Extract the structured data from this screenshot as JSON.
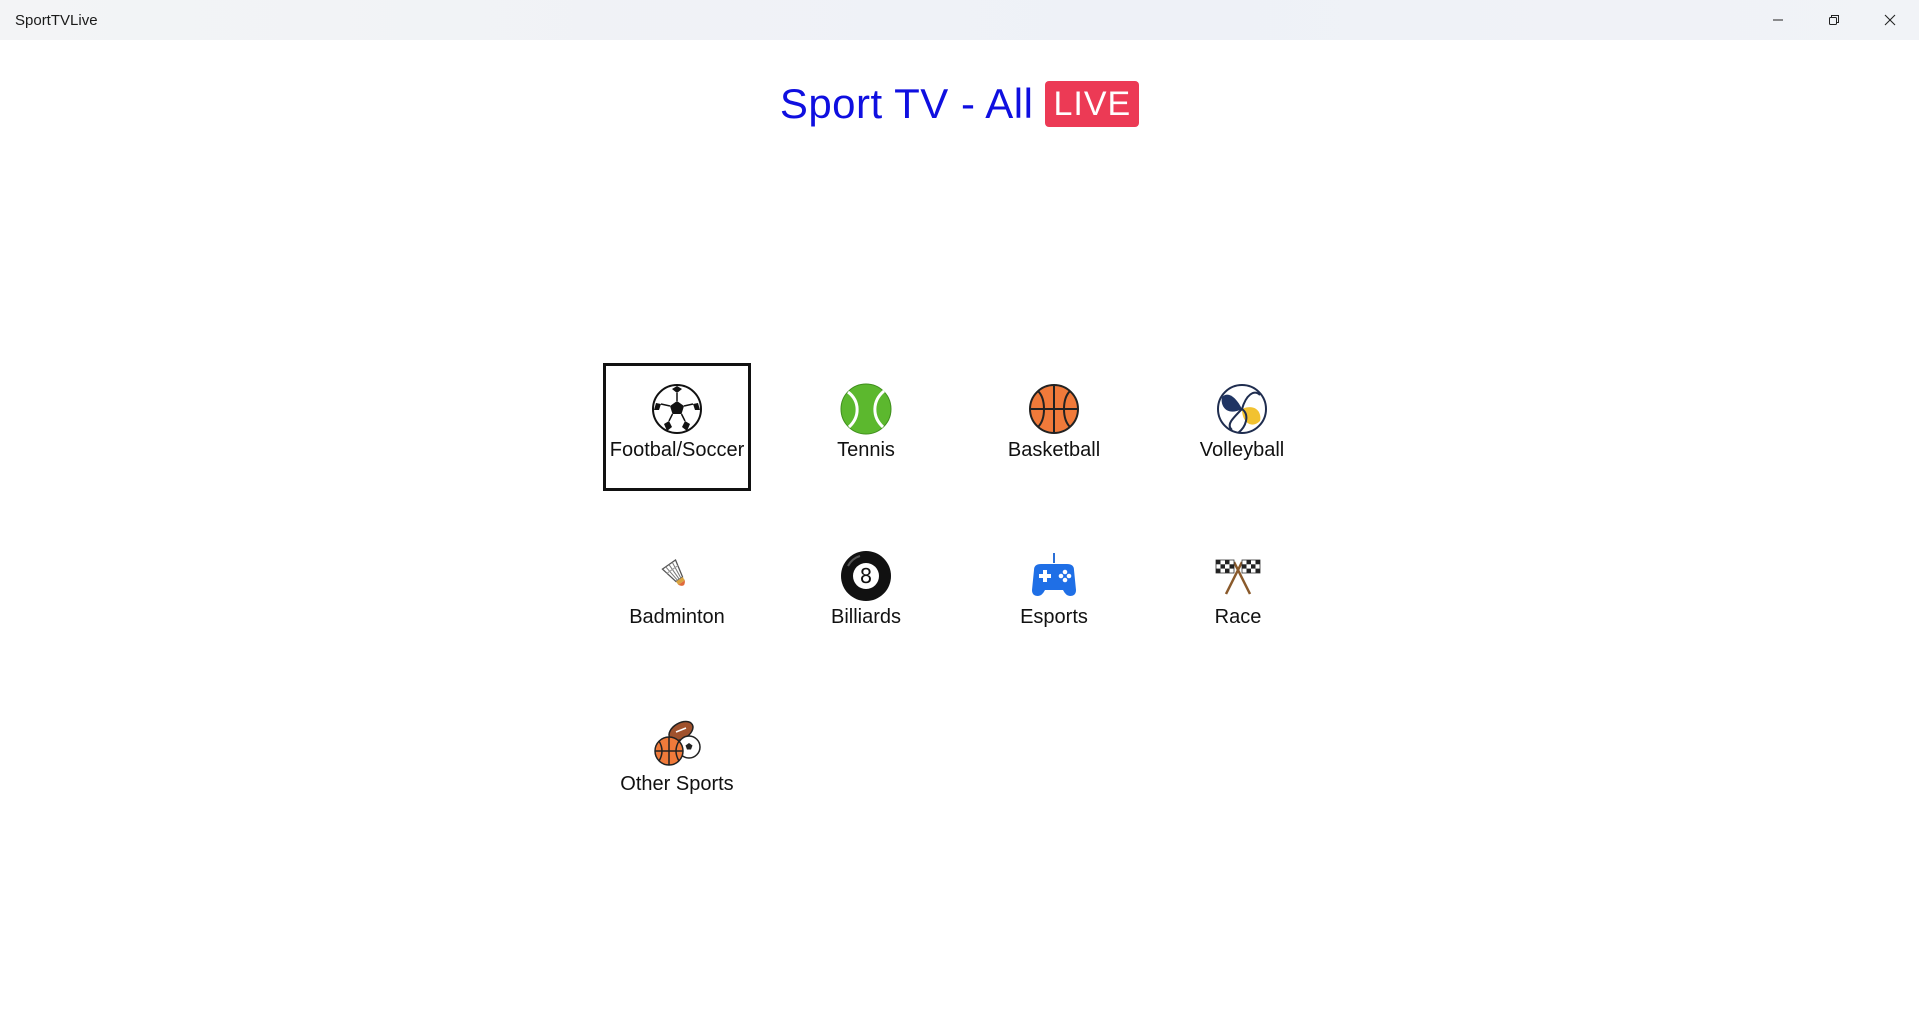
{
  "window": {
    "title": "SportTVLive",
    "controls": {
      "minimize_icon": "minimize-icon",
      "maximize_icon": "restore-icon",
      "close_icon": "close-icon"
    }
  },
  "header": {
    "title": "Sport TV - All",
    "badge": "LIVE",
    "title_color": "#0f0fe0",
    "badge_color": "#ec3a55"
  },
  "sports": [
    {
      "label": "Footbal/Soccer",
      "icon": "soccer-ball-icon",
      "selected": true
    },
    {
      "label": "Tennis",
      "icon": "tennis-ball-icon",
      "selected": false
    },
    {
      "label": "Basketball",
      "icon": "basketball-icon",
      "selected": false
    },
    {
      "label": "Volleyball",
      "icon": "volleyball-icon",
      "selected": false
    },
    {
      "label": "Badminton",
      "icon": "shuttlecock-icon",
      "selected": false
    },
    {
      "label": "Billiards",
      "icon": "eight-ball-icon",
      "selected": false
    },
    {
      "label": "Esports",
      "icon": "gamepad-icon",
      "selected": false
    },
    {
      "label": "Race",
      "icon": "checkered-flags-icon",
      "selected": false
    },
    {
      "label": "Other Sports",
      "icon": "sports-balls-icon",
      "selected": false
    }
  ]
}
